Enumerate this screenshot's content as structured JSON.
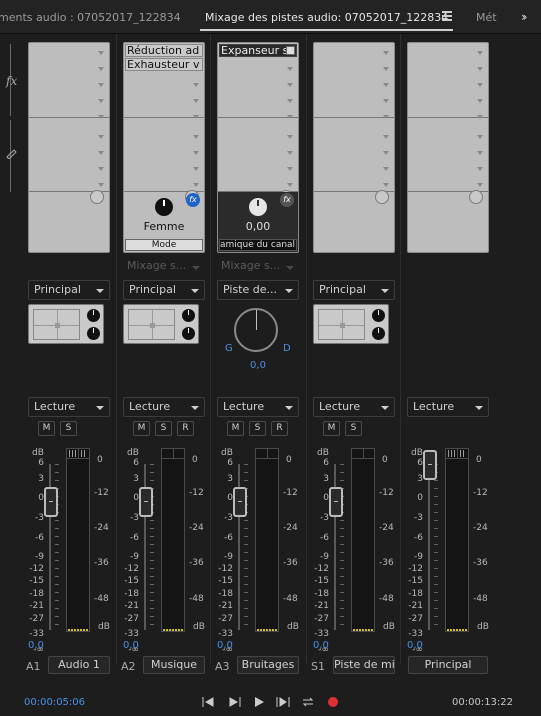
{
  "tabs": [
    {
      "label": "ments audio : 07052017_122834",
      "active": false
    },
    {
      "label": "Mixage des pistes audio: 07052017_122834",
      "active": true
    },
    {
      "label": "Mét",
      "active": false
    }
  ],
  "colors": {
    "accent": "#4a90e2",
    "fx_active": "#1f64c8",
    "record": "#e03030",
    "meter_floor": "#d4c21a"
  },
  "left_strip": {
    "fx_label": "fx"
  },
  "tracks": [
    {
      "id": "A1",
      "name": "Audio 1",
      "effects": [],
      "send": "",
      "output": "Principal",
      "panner": "surround",
      "automation": "Lecture",
      "buttons": [
        "M",
        "S"
      ],
      "volume": "0,0"
    },
    {
      "id": "A2",
      "name": "Musique",
      "effects": [
        "Réduction ad",
        "Exhausteur v"
      ],
      "param_name": "Femme",
      "param_mode": "Mode",
      "send": "Mixage s...",
      "output": "Principal",
      "panner": "surround",
      "automation": "Lecture",
      "buttons": [
        "M",
        "S",
        "R"
      ],
      "volume": "0,0"
    },
    {
      "id": "A3",
      "name": "Bruitages",
      "effects": [
        "Expanseur st"
      ],
      "param_value": "0,00",
      "param_mode": "amique du canal se",
      "send": "Mixage s...",
      "output": "Piste de...",
      "panner": "balance",
      "pan_left": "G",
      "pan_right": "D",
      "pan_value": "0,0",
      "automation": "Lecture",
      "buttons": [
        "M",
        "S",
        "R"
      ],
      "volume": "0,0"
    },
    {
      "id": "S1",
      "name": "Piste de mix",
      "effects": [],
      "send": "",
      "output": "Principal",
      "panner": "surround",
      "automation": "Lecture",
      "buttons": [
        "M",
        "S"
      ],
      "volume": "0,0"
    },
    {
      "id": "",
      "name": "Principal",
      "effects": [],
      "send": "",
      "output": "",
      "panner": "none",
      "automation": "Lecture",
      "buttons": [],
      "volume": "0,0"
    }
  ],
  "fader_scale": [
    "dB",
    "6",
    "3",
    "0",
    "-3",
    "-6",
    "-9",
    "-12",
    "-15",
    "-18",
    "-21",
    "-27",
    "-33",
    "-∞"
  ],
  "meter_scale": [
    "0",
    "-12",
    "-24",
    "-36",
    "-48",
    "dB"
  ],
  "transport": {
    "current_time": "00:00:05:06",
    "total_time": "00:00:13:22"
  }
}
